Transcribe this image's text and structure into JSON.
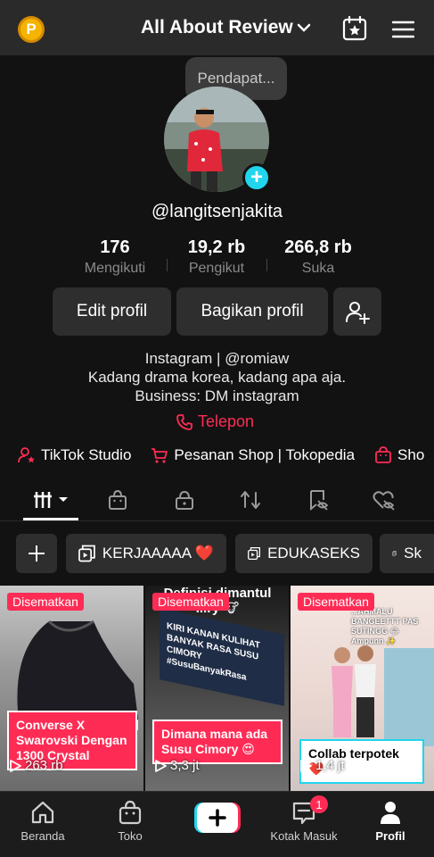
{
  "header": {
    "account_name": "All About Review",
    "coin_letter": "P"
  },
  "profile": {
    "tooltip": "Pendapat...",
    "username": "@langitsenjakita",
    "stats": [
      {
        "value": "176",
        "label": "Mengikuti"
      },
      {
        "value": "19,2 rb",
        "label": "Pengikut"
      },
      {
        "value": "266,8 rb",
        "label": "Suka"
      }
    ],
    "edit_label": "Edit profil",
    "share_label": "Bagikan profil",
    "bio": [
      "Instagram | @romiaw",
      "Kadang drama korea, kadang apa aja.",
      "Business: DM instagram"
    ],
    "phone_label": "Telepon"
  },
  "links": [
    {
      "label": "TikTok Studio",
      "icon": "person-star-icon"
    },
    {
      "label": "Pesanan Shop | Tokopedia",
      "icon": "cart-icon"
    },
    {
      "label": "Sho",
      "icon": "shop-bag-icon"
    }
  ],
  "collections": [
    {
      "label": "KERJAAAAA ❤️"
    },
    {
      "label": "EDUKASEKS"
    },
    {
      "label": "Sk"
    }
  ],
  "videos": [
    {
      "pinned": "Disematkan",
      "caption": "Converse X Swarovski Dengan 1300 Crystal",
      "views": "263 rb",
      "overlay": ""
    },
    {
      "pinned": "Disematkan",
      "caption": "Dimana mana ada Susu Cimory 😍",
      "views": "3,3 jt",
      "overlay": "Definisi dimantul ...ry 🐮",
      "sign": "KIRI KANAN KULIHAT BANYAK RASA SUSU CIMORY #SusuBanyakRasa"
    },
    {
      "pinned": "Disematkan",
      "caption": "Collab terpotek ❤️",
      "views": "1,4 jt",
      "overlay": "...AHMALU BANGEETTT PAS SUTINGG 😂 Ampunn ✨"
    }
  ],
  "bottom_nav": [
    {
      "label": "Beranda"
    },
    {
      "label": "Toko"
    },
    {
      "label": "Kotak Masuk",
      "badge": "1"
    },
    {
      "label": "Profil"
    }
  ],
  "colors": {
    "accent": "#fe2c55",
    "teal": "#20d5ec",
    "background": "#121212"
  }
}
